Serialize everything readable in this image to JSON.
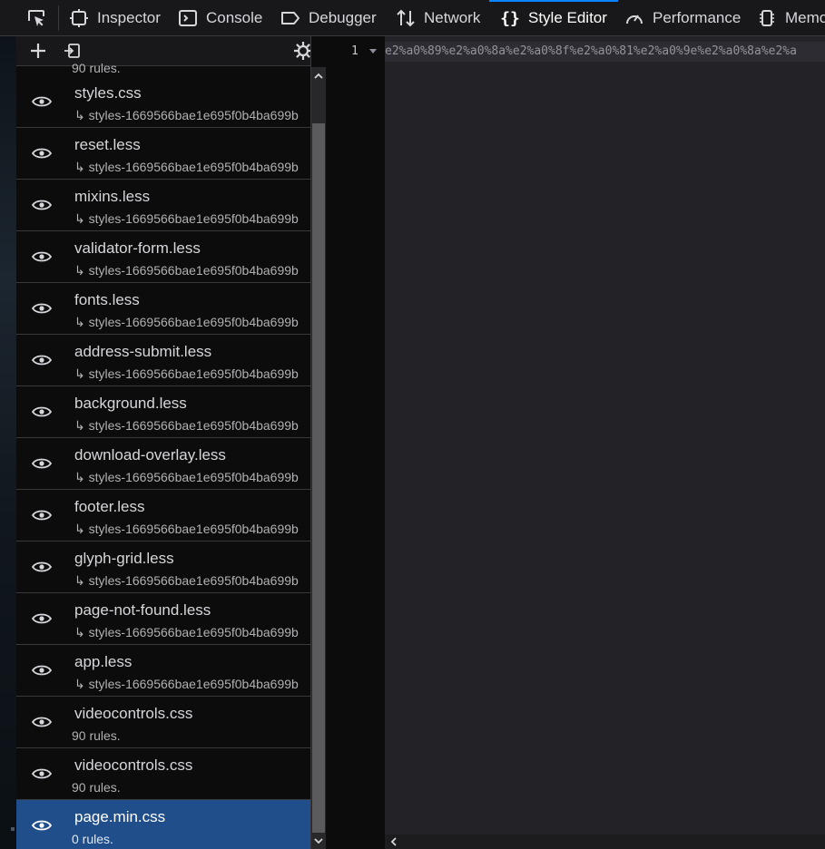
{
  "toolbar": {
    "picker_icon": "element-picker-icon",
    "tabs": [
      {
        "label": "Inspector",
        "icon": "inspector-icon"
      },
      {
        "label": "Console",
        "icon": "console-icon"
      },
      {
        "label": "Debugger",
        "icon": "debugger-icon"
      },
      {
        "label": "Network",
        "icon": "network-icon"
      },
      {
        "label": "Style Editor",
        "icon": "style-editor-icon",
        "active": true
      },
      {
        "label": "Performance",
        "icon": "performance-icon"
      },
      {
        "label": "Memo",
        "icon": "memory-icon"
      }
    ]
  },
  "sidebar": {
    "toolbar": {
      "new_icon": "plus-icon",
      "import_icon": "import-icon",
      "settings_icon": "gear-icon"
    },
    "partial_rules": "90 rules.",
    "items": [
      {
        "name": "styles.css",
        "sub": "↳ styles-1669566bae1e695f0b4ba699b"
      },
      {
        "name": "reset.less",
        "sub": "↳ styles-1669566bae1e695f0b4ba699b"
      },
      {
        "name": "mixins.less",
        "sub": "↳ styles-1669566bae1e695f0b4ba699b"
      },
      {
        "name": "validator-form.less",
        "sub": "↳ styles-1669566bae1e695f0b4ba699b"
      },
      {
        "name": "fonts.less",
        "sub": "↳ styles-1669566bae1e695f0b4ba699b"
      },
      {
        "name": "address-submit.less",
        "sub": "↳ styles-1669566bae1e695f0b4ba699b"
      },
      {
        "name": "background.less",
        "sub": "↳ styles-1669566bae1e695f0b4ba699b"
      },
      {
        "name": "download-overlay.less",
        "sub": "↳ styles-1669566bae1e695f0b4ba699b"
      },
      {
        "name": "footer.less",
        "sub": "↳ styles-1669566bae1e695f0b4ba699b"
      },
      {
        "name": "glyph-grid.less",
        "sub": "↳ styles-1669566bae1e695f0b4ba699b"
      },
      {
        "name": "page-not-found.less",
        "sub": "↳ styles-1669566bae1e695f0b4ba699b"
      },
      {
        "name": "app.less",
        "sub": "↳ styles-1669566bae1e695f0b4ba699b"
      },
      {
        "name": "videocontrols.css",
        "rules": "90 rules."
      },
      {
        "name": "videocontrols.css",
        "rules": "90 rules."
      },
      {
        "name": "page.min.css",
        "rules": "0 rules.",
        "selected": true
      }
    ]
  },
  "editor": {
    "line_number": "1",
    "code": "e2%a0%89%e2%a0%8a%e2%a0%8f%e2%a0%81%e2%a0%9e%e2%a0%8a%e2%a"
  },
  "colors": {
    "accent": "#0a84ff",
    "selected_row": "#204e8a"
  }
}
